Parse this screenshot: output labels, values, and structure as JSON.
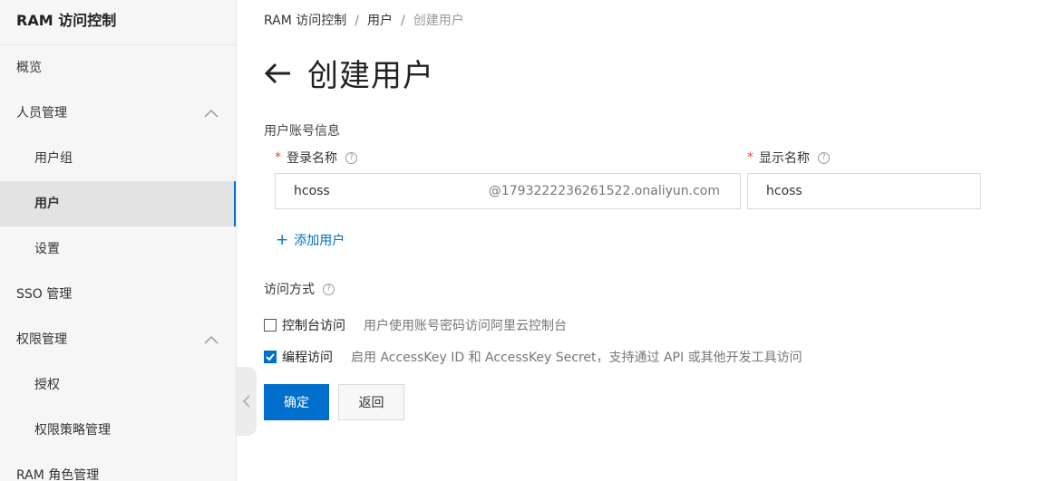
{
  "sidebar": {
    "title": "RAM 访问控制",
    "items": [
      {
        "label": "概览"
      },
      {
        "label": "人员管理"
      },
      {
        "label": "用户组"
      },
      {
        "label": "用户"
      },
      {
        "label": "设置"
      },
      {
        "label": "SSO 管理"
      },
      {
        "label": "权限管理"
      },
      {
        "label": "授权"
      },
      {
        "label": "权限策略管理"
      },
      {
        "label": "RAM 角色管理"
      }
    ]
  },
  "breadcrumb": {
    "items": [
      "RAM 访问控制",
      "用户",
      "创建用户"
    ],
    "separator": "/"
  },
  "page": {
    "title": "创建用户",
    "back_icon": "arrow-left-icon"
  },
  "account_info": {
    "section_label": "用户账号信息",
    "login_name": {
      "required_mark": "*",
      "label": "登录名称",
      "value": "hcoss",
      "suffix": "@1793222236261522.onaliyun.com"
    },
    "display_name": {
      "required_mark": "*",
      "label": "显示名称",
      "value": "hcoss"
    },
    "add_user": {
      "plus": "+",
      "label": "添加用户"
    }
  },
  "access": {
    "section_label": "访问方式",
    "console": {
      "label": "控制台访问",
      "description": "用户使用账号密码访问阿里云控制台",
      "checked": false
    },
    "programmatic": {
      "label": "编程访问",
      "description": "启用 AccessKey ID 和 AccessKey Secret，支持通过 API 或其他开发工具访问",
      "checked": true
    }
  },
  "actions": {
    "confirm": "确定",
    "back": "返回"
  },
  "colors": {
    "accent": "#0070cc",
    "required": "#e84738",
    "sidebar_bg": "#f6f6f6"
  }
}
